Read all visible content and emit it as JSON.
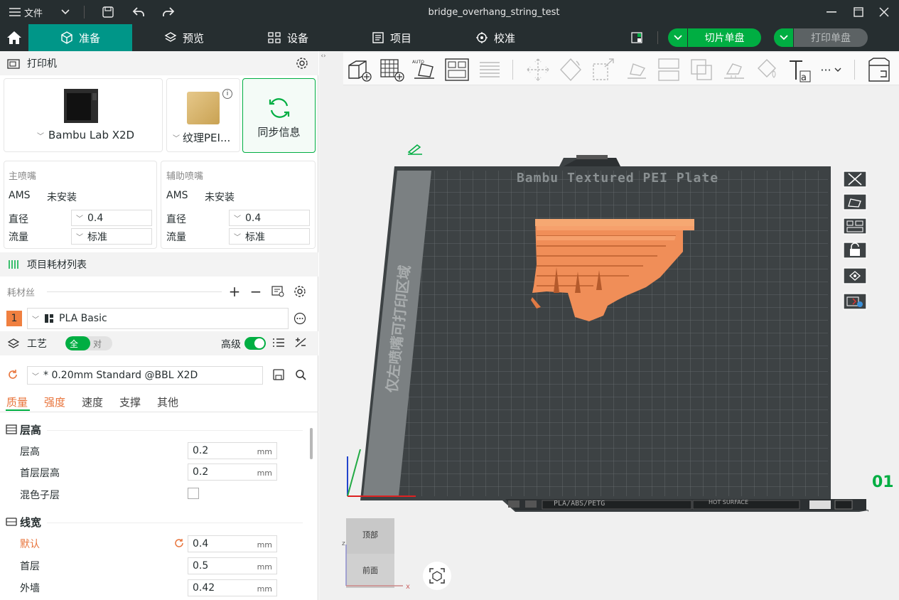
{
  "titlebar": {
    "menu_label": "文件",
    "file_name": "bridge_overhang_string_test"
  },
  "tabs": [
    {
      "label": "准备",
      "icon": "cube-icon",
      "active": true
    },
    {
      "label": "预览",
      "icon": "layers-icon",
      "active": false
    },
    {
      "label": "设备",
      "icon": "device-icon",
      "active": false
    },
    {
      "label": "项目",
      "icon": "project-icon",
      "active": false
    },
    {
      "label": "校准",
      "icon": "calibrate-icon",
      "active": false
    }
  ],
  "actions": {
    "slice_label": "切片单盘",
    "print_label": "打印单盘"
  },
  "printer": {
    "section_title": "打印机",
    "printer_name": "Bambu Lab X2D",
    "plate_name": "纹理PEI...",
    "sync_label": "同步信息"
  },
  "nozzles": {
    "main": {
      "title": "主喷嘴",
      "ams_label": "AMS",
      "ams_value": "未安装",
      "diameter_label": "直径",
      "diameter_value": "0.4",
      "flow_label": "流量",
      "flow_value": "标准"
    },
    "aux": {
      "title": "辅助喷嘴",
      "ams_label": "AMS",
      "ams_value": "未安装",
      "diameter_label": "直径",
      "diameter_value": "0.4",
      "flow_label": "流量",
      "flow_value": "标准"
    }
  },
  "filament": {
    "section_title": "项目耗材列表",
    "list_label": "耗材丝",
    "items": [
      {
        "index": "1",
        "name": "PLA Basic",
        "color": "#f08040"
      }
    ]
  },
  "process": {
    "section_title": "工艺",
    "toggle_global": "全局",
    "toggle_object": "对象",
    "advanced_label": "高级",
    "preset_name": "* 0.20mm Standard @BBL X2D",
    "subtabs": [
      "质量",
      "强度",
      "速度",
      "支撑",
      "其他"
    ],
    "groups": [
      {
        "title": "层高",
        "rows": [
          {
            "label": "层高",
            "value": "0.2",
            "unit": "mm"
          },
          {
            "label": "首层层高",
            "value": "0.2",
            "unit": "mm"
          },
          {
            "label": "混色子层",
            "value": "",
            "unit": ""
          }
        ]
      },
      {
        "title": "线宽",
        "rows": [
          {
            "label": "默认",
            "value": "0.4",
            "unit": "mm"
          },
          {
            "label": "首层",
            "value": "0.5",
            "unit": "mm"
          },
          {
            "label": "外墙",
            "value": "0.42",
            "unit": "mm"
          }
        ]
      }
    ]
  },
  "viewport": {
    "plate_title": "Bambu Textured PEI Plate",
    "left_zone_text": "仅左喷嘴可打印区域",
    "plate_footer_material": "PLA/ABS/PETG",
    "plate_footer_hot": "HOT SURFACE",
    "plate_number": "01",
    "view_top": "顶部",
    "view_front": "前面",
    "axis_z": "z",
    "axis_x": "x",
    "overflow_menu": "···"
  },
  "colors": {
    "accent": "#009688",
    "bright_green": "#00ae42",
    "dark_bar": "#262e30",
    "model": "#f08e58",
    "plate": "#3d4244",
    "orange_text": "#e8743b"
  }
}
